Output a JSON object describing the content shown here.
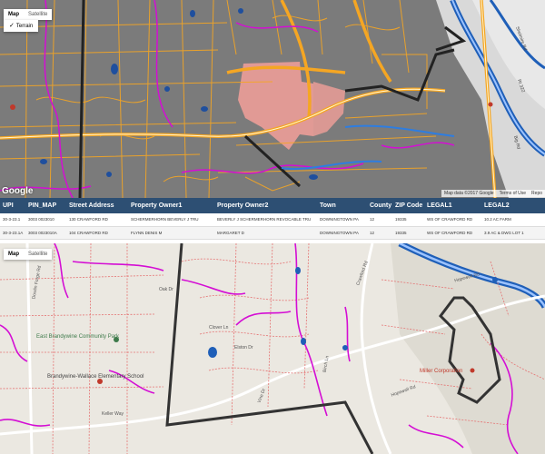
{
  "top_map": {
    "map_type_buttons": [
      "Map",
      "Satellite"
    ],
    "active_type": "Map",
    "terrain_option": "Terrain",
    "terrain_checked": true,
    "logo": "Google",
    "attribution": [
      "Map data ©2017 Google",
      "Terms of Use",
      "Repo"
    ],
    "road_labels": [
      "Shelmire Rd",
      "Rt 322",
      "Big Rd"
    ]
  },
  "table": {
    "headers": [
      "UPI",
      "PIN_MAP",
      "Street Address",
      "Property Owner1",
      "Property Owner2",
      "Town",
      "County",
      "ZIP Code",
      "LEGAL1",
      "LEGAL2"
    ],
    "rows": [
      [
        "30-3-23.1",
        "3003 0023010",
        "130 CRAWFORD RD",
        "SCHERMERHORN BEVERLY J TRU",
        "BEVERLY J SCHERMERHORN REVOCABLE TRU",
        "DOWNINGTOWN PA",
        "12",
        "19335",
        "WS OF CRAWFORD RD",
        "10.2 AC FARM"
      ],
      [
        "30-3-23.1A",
        "3003 0023010A",
        "104 CRAWFORD RD",
        "FLYNN DENIS M",
        "MARGARET D",
        "DOWNINGTOWN PA",
        "12",
        "19335",
        "WS OF CRAWFORD RD",
        "3.9 AC & DWG LOT 1"
      ]
    ]
  },
  "bottom_map": {
    "map_type_buttons": [
      "Map",
      "Satellite"
    ],
    "active_type": "Map",
    "places": {
      "park": "East Brandywine Community Park",
      "school": "Brandywine-Wallace Elementary School",
      "poi": "Miller Corporation"
    },
    "road_labels": [
      "Dowlin Forge Rd",
      "Oak Dr",
      "Clover Ln",
      "Elston Dr",
      "Birch Ln",
      "Crawford Rd",
      "Hopewell Rd",
      "Keller Way",
      "Vine Dr",
      "Hopewell Rd"
    ]
  },
  "colors": {
    "table_header": "#2d4f73",
    "road_yellow": "#f5a623",
    "stream": "#d40ed4",
    "boundary": "#333333",
    "parcel_fill": "#f3a09a"
  }
}
